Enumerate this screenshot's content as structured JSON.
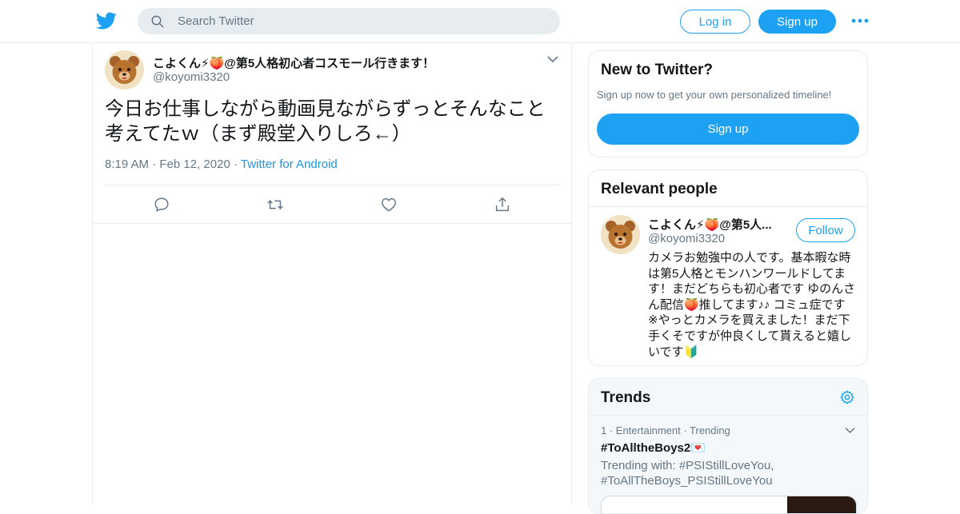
{
  "colors": {
    "brand": "#1da1f2",
    "link": "#1b95e0",
    "muted": "#657786",
    "text": "#14171a",
    "border": "#e6ecf0"
  },
  "topbar": {
    "logo_icon": "twitter-bird-icon",
    "search_placeholder": "Search Twitter",
    "login_label": "Log in",
    "signup_label": "Sign up",
    "more_icon": "more-dots-icon"
  },
  "tweet": {
    "author_name": "こよくん⚡🍑@第5人格初心者コスモール行きます！",
    "author_handle": "@koyomi3320",
    "text": "今日お仕事しながら動画見ながらずっとそんなこと考えてたｗ（まず殿堂入りしろ←）",
    "time": "8:19 AM",
    "date": "Feb 12, 2020",
    "source": "Twitter for Android",
    "actions": [
      "reply-icon",
      "retweet-icon",
      "like-icon",
      "share-icon"
    ]
  },
  "new_to_twitter": {
    "heading": "New to Twitter?",
    "subtext": "Sign up now to get your own personalized timeline!",
    "button_label": "Sign up"
  },
  "relevant_people": {
    "heading": "Relevant people",
    "name": "こよくん⚡🍑@第5人...",
    "handle": "@koyomi3320",
    "follow_label": "Follow",
    "bio": "カメラお勉強中の人です。基本暇な時は第5人格とモンハンワールドしてます！まだどちらも初心者です ゆのんさん配信🍑推してます♪♪ コミュ症です ※やっとカメラを買えました！まだ下手くそですが仲良くして貰えると嬉しいです🔰"
  },
  "trends": {
    "heading": "Trends",
    "items": [
      {
        "meta": "1 · Entertainment · Trending",
        "name": "#ToAlltheBoys2💌",
        "with": "Trending with: #PSIStillLoveYou, #ToAllTheBoys_PSIStillLoveYou"
      }
    ]
  }
}
